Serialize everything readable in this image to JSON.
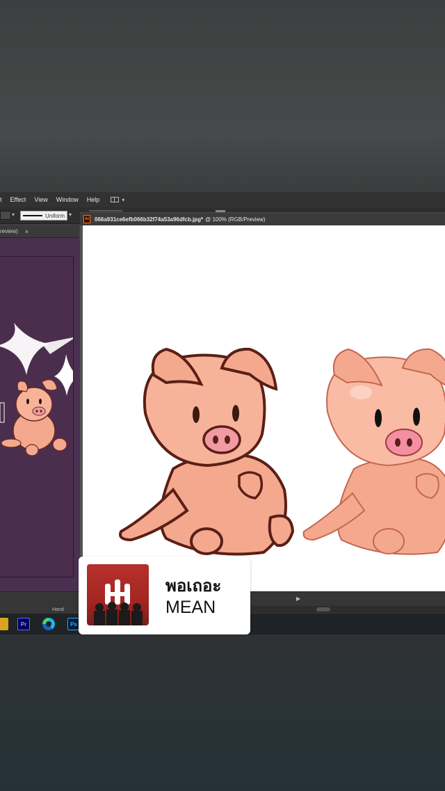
{
  "menubar": {
    "items": [
      "t",
      "Effect",
      "View",
      "Window",
      "Help"
    ]
  },
  "control_bar": {
    "stroke_profile": "Uniform"
  },
  "left_document": {
    "tab_label": "review)",
    "close": "×"
  },
  "main_document": {
    "badge": "Ai",
    "filename": "066a931ce6efb066b32f74a53a96dfcb.jpg*",
    "zoom_meta": "@ 100% (RGB/Preview)"
  },
  "status_bar": {
    "tool": "Hand",
    "nav": "▶"
  },
  "taskbar": {
    "apps": [
      "Pr",
      "Edge",
      "Ps"
    ]
  },
  "music_sticker": {
    "title": "พอเถอะ",
    "artist": "MEAN"
  },
  "colors": {
    "artboard_purple": "#4b2d4e",
    "pig_skin": "#f4a98f",
    "pig_outline": "#6b2a1e",
    "ai_orange": "#ff7c00"
  }
}
